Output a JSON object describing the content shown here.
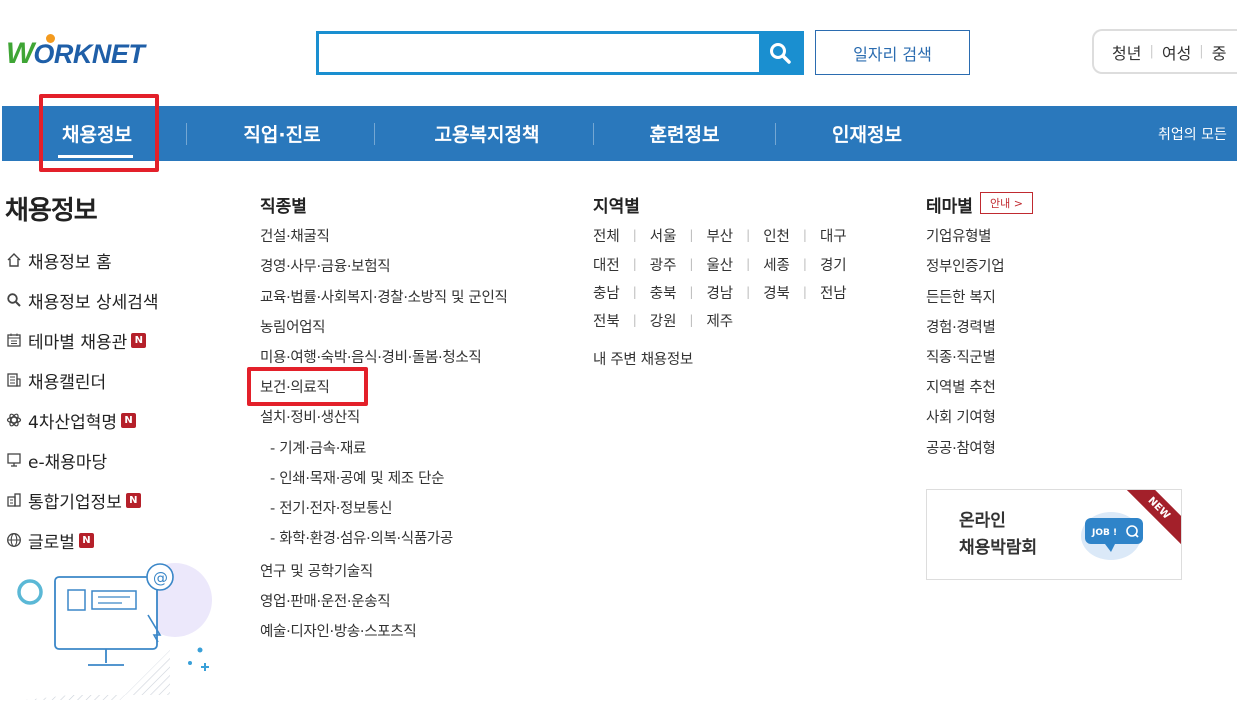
{
  "header": {
    "logo_w": "W",
    "logo_rest": "ORKNET",
    "search_placeholder": "",
    "search_value": "",
    "job_search_label": "일자리 검색",
    "quick_links": [
      "청년",
      "여성",
      "중"
    ]
  },
  "gnb": {
    "items": [
      "채용정보",
      "직업·진로",
      "고용복지정책",
      "훈련정보",
      "인재정보"
    ],
    "right_text": "취업의 모든"
  },
  "sidebar": {
    "title": "채용정보",
    "items": [
      {
        "label": "채용정보 홈",
        "icon": "home-icon",
        "new": false
      },
      {
        "label": "채용정보 상세검색",
        "icon": "search-icon",
        "new": false
      },
      {
        "label": "테마별 채용관",
        "icon": "calendar-icon",
        "new": true
      },
      {
        "label": "채용캘린더",
        "icon": "building-icon",
        "new": false
      },
      {
        "label": "4차산업혁명",
        "icon": "atom-icon",
        "new": true
      },
      {
        "label": "e-채용마당",
        "icon": "monitor-icon",
        "new": false
      },
      {
        "label": "통합기업정보",
        "icon": "company-icon",
        "new": true
      },
      {
        "label": "글로벌",
        "icon": "globe-icon",
        "new": true
      }
    ],
    "new_badge": "N"
  },
  "job_types": {
    "title": "직종별",
    "items": [
      "건설·채굴직",
      "경영·사무·금융·보험직",
      "교육·법률·사회복지·경찰·소방직 및 군인직",
      "농림어업직",
      "미용·여행·숙박·음식·경비·돌봄·청소직",
      "보건·의료직",
      "설치·정비·생산직",
      "- 기계·금속·재료",
      "- 인쇄·목재·공예 및 제조 단순",
      "- 전기·전자·정보통신",
      "- 화학·환경·섬유·의복·식품가공",
      "연구 및 공학기술직",
      "영업·판매·운전·운송직",
      "예술·디자인·방송·스포츠직"
    ]
  },
  "regions": {
    "title": "지역별",
    "rows": [
      [
        "전체",
        "서울",
        "부산",
        "인천",
        "대구"
      ],
      [
        "대전",
        "광주",
        "울산",
        "세종",
        "경기"
      ],
      [
        "충남",
        "충북",
        "경남",
        "경북",
        "전남"
      ],
      [
        "전북",
        "강원",
        "제주"
      ]
    ],
    "nearby": "내 주변 채용정보"
  },
  "themes": {
    "title": "테마별",
    "guide_label": "안내 >",
    "items": [
      "기업유형별",
      "정부인증기업",
      "든든한 복지",
      "경험·경력별",
      "직종·직군별",
      "지역별 추천",
      "사회 기여형",
      "공공·참여형"
    ]
  },
  "banner": {
    "line1": "온라인",
    "line2": "채용박람회",
    "ribbon": "NEW",
    "job_tag": "JOB !"
  },
  "colors": {
    "nav_bg": "#2a78bc",
    "accent_blue": "#1a8fd0",
    "highlight_red": "#e3202a",
    "badge_red": "#b5202a"
  }
}
